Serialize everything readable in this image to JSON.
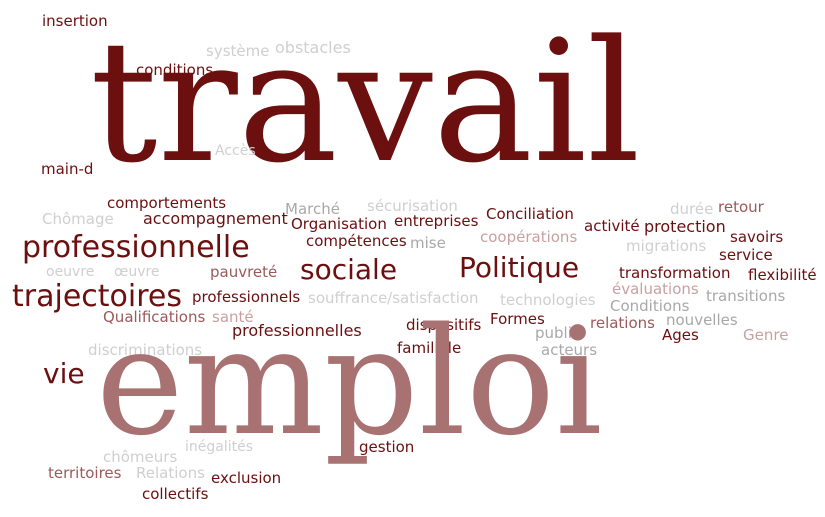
{
  "words": {
    "insertion": "insertion",
    "systeme": "système",
    "obstacles": "obstacles",
    "conditions": "conditions",
    "travail": "travail",
    "acces": "Accès",
    "main_d": "main-d",
    "comportements": "comportements",
    "securisation": "sécurisation",
    "duree": "durée",
    "retour": "retour",
    "chomage": "Chômage",
    "accompagnement": "accompagnement",
    "marche": "Marché",
    "organisation": "Organisation",
    "entreprises": "entreprises",
    "conciliation": "Conciliation",
    "activite": "activité",
    "protection": "protection",
    "savoirs": "savoirs",
    "competences": "compétences",
    "mise": "mise",
    "cooperations": "coopérations",
    "migrations": "migrations",
    "service": "service",
    "professionnelle": "professionnelle",
    "oeuvre1": "oeuvre",
    "oeuvre2": "œuvre",
    "pauvrete": "pauvreté",
    "sociale": "sociale",
    "politique": "Politique",
    "transformation": "transformation",
    "flexibilite": "flexibilité",
    "evaluations": "évaluations",
    "transitions": "transitions",
    "trajectoires": "trajectoires",
    "professionnels": "professionnels",
    "souffrance": "souffrance/satisfaction",
    "technologies": "technologies",
    "conditions2": "Conditions",
    "qualifications": "Qualifications",
    "sante": "santé",
    "dispositifs": "dispositifs",
    "formes": "Formes",
    "relations": "relations",
    "nouvelles": "nouvelles",
    "public": "public",
    "ages": "Ages",
    "genre": "Genre",
    "professionnelles": "professionnelles",
    "familiale": "familiale",
    "acteurs": "acteurs",
    "discriminations": "discriminations",
    "vie": "vie",
    "emploi": "emploi",
    "inegalites": "inégalités",
    "chomeurs": "chômeurs",
    "gestion": "gestion",
    "territoires": "territoires",
    "relations2": "Relations",
    "exclusion": "exclusion",
    "collectifs": "collectifs"
  }
}
